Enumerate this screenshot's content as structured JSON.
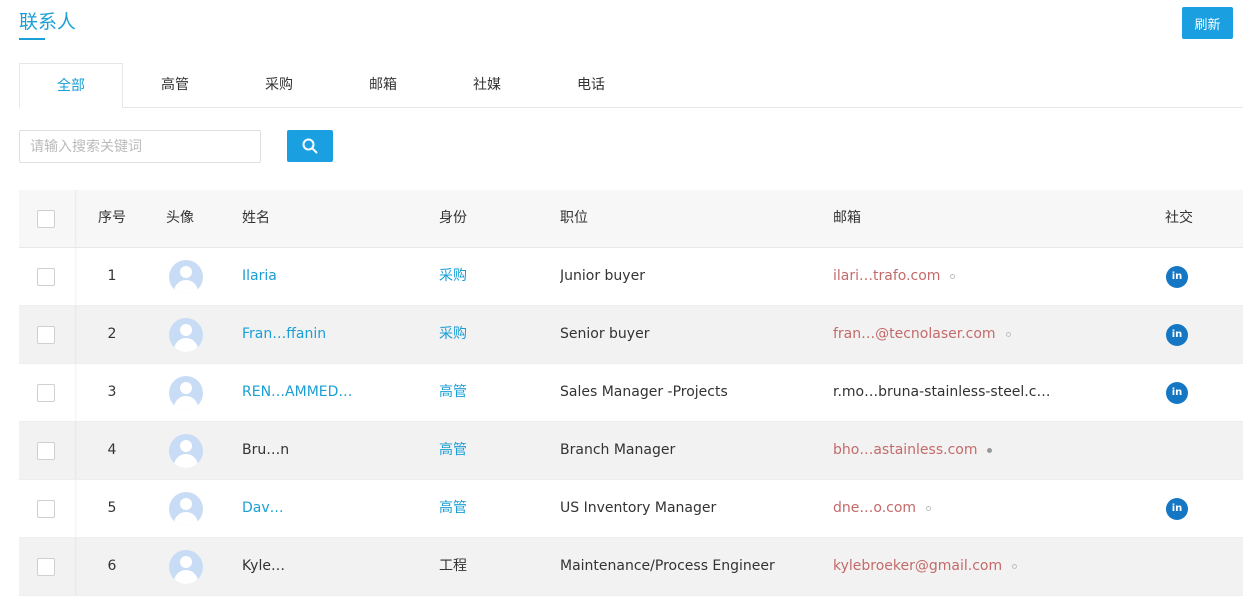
{
  "page": {
    "title": "联系人",
    "refresh_label": "刷新"
  },
  "tabs": [
    {
      "label": "全部",
      "active": true
    },
    {
      "label": "高管"
    },
    {
      "label": "采购"
    },
    {
      "label": "邮箱"
    },
    {
      "label": "社媒"
    },
    {
      "label": "电话"
    }
  ],
  "search": {
    "placeholder": "请输入搜索关键词"
  },
  "table": {
    "headers": {
      "index": "序号",
      "avatar": "头像",
      "name": "姓名",
      "role": "身份",
      "title": "职位",
      "email": "邮箱",
      "social": "社交"
    },
    "rows": [
      {
        "index": "1",
        "name": "Ilaria",
        "role": "采购",
        "title": "Junior buyer",
        "email": "ilari…trafo.com",
        "linkedin": "in"
      },
      {
        "index": "2",
        "name": "Fran…ffanin",
        "role": "采购",
        "title": "Senior buyer",
        "email": "fran…@tecnolaser.com",
        "linkedin": "in"
      },
      {
        "index": "3",
        "name": "REN…AMMED…",
        "role": "高管",
        "title": "Sales Manager -Projects",
        "email": "r.mo…bruna-stainless-steel.c…",
        "linkedin": "in"
      },
      {
        "index": "4",
        "name": "Bru…n",
        "role": "高管",
        "title": "Branch Manager",
        "email": "bho…astainless.com"
      },
      {
        "index": "5",
        "name": "Dav…",
        "role": "高管",
        "title": "US Inventory Manager",
        "email": "dne…o.com",
        "linkedin": "in"
      },
      {
        "index": "6",
        "name": "Kyle…",
        "role": "工程",
        "title": "Maintenance/Process Engineer",
        "email": "kylebroeker@gmail.com"
      }
    ]
  },
  "colors": {
    "accent": "#1a9fd6",
    "email": "#c46a6a",
    "linkedin": "#1577c4"
  }
}
